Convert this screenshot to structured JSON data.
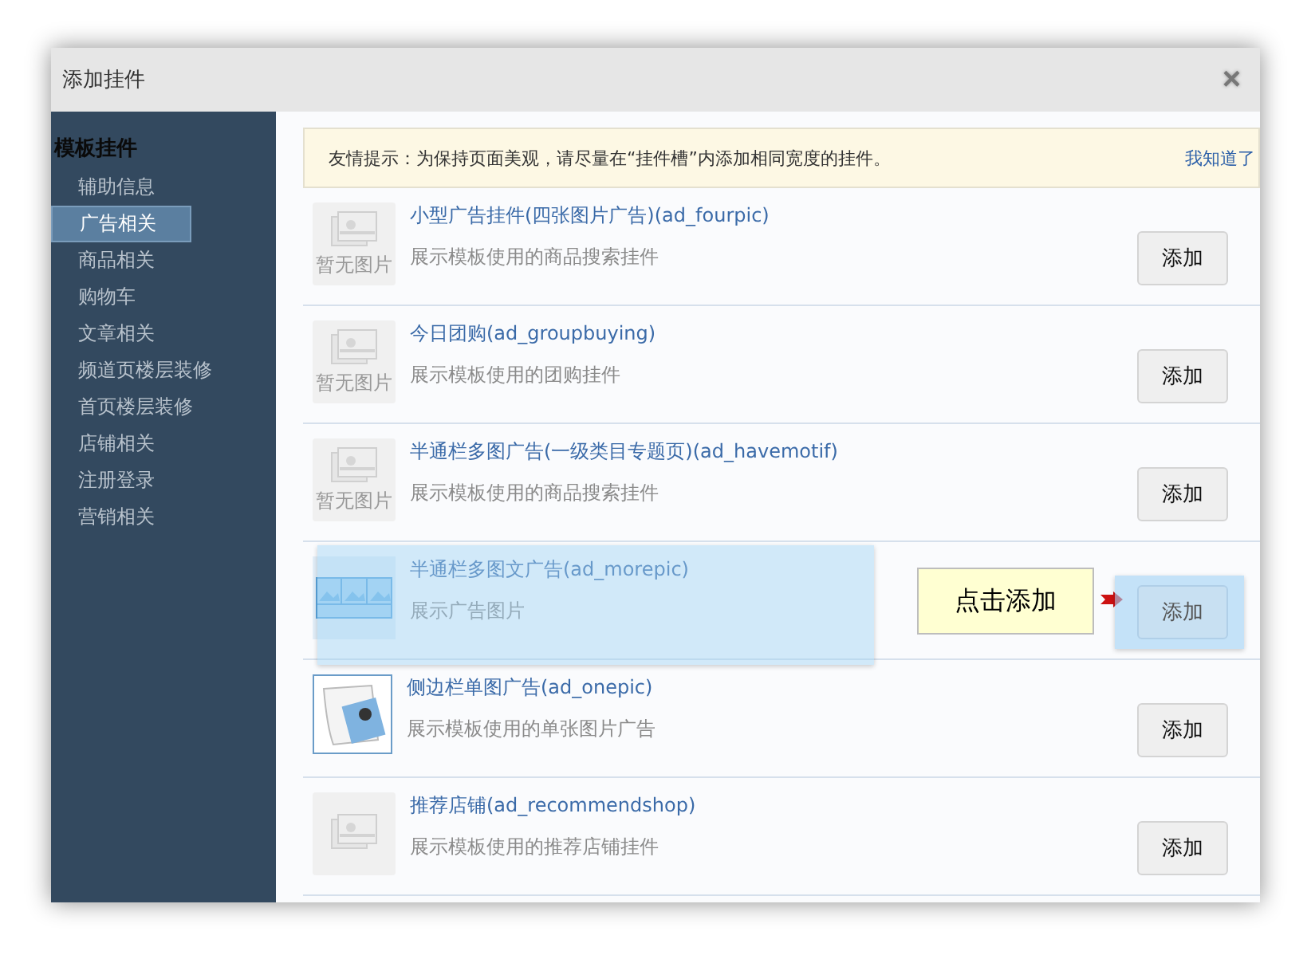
{
  "window": {
    "title": "添加挂件",
    "close": "×"
  },
  "sidebar": {
    "heading": "模板挂件",
    "items": [
      {
        "label": "辅助信息",
        "selected": false
      },
      {
        "label": "广告相关",
        "selected": true
      },
      {
        "label": "商品相关",
        "selected": false
      },
      {
        "label": "购物车",
        "selected": false
      },
      {
        "label": "文章相关",
        "selected": false
      },
      {
        "label": "频道页楼层装修",
        "selected": false
      },
      {
        "label": "首页楼层装修",
        "selected": false
      },
      {
        "label": "店铺相关",
        "selected": false
      },
      {
        "label": "注册登录",
        "selected": false
      },
      {
        "label": "营销相关",
        "selected": false
      }
    ]
  },
  "tip": {
    "text": "友情提示：为保持页面美观，请尽量在“挂件槽”内添加相同宽度的挂件。",
    "link": "我知道了"
  },
  "widgets": [
    {
      "kind": "placeholder",
      "thumb_text": "暂无图片",
      "title": "小型广告挂件(四张图片广告)(ad_fourpic)",
      "description": "展示模板使用的商品搜索挂件",
      "button": "添加",
      "dragging": false
    },
    {
      "kind": "placeholder",
      "thumb_text": "暂无图片",
      "title": "今日团购(ad_groupbuying)",
      "description": "展示模板使用的团购挂件",
      "button": "添加",
      "dragging": false
    },
    {
      "kind": "placeholder",
      "thumb_text": "暂无图片",
      "title": "半通栏多图广告(一级类目专题页)(ad_havemotif)",
      "description": "展示模板使用的商品搜索挂件",
      "button": "添加",
      "dragging": false
    },
    {
      "kind": "multipic",
      "title": "半通栏多图文广告(ad_morepic)",
      "description": "展示广告图片",
      "button": "添加",
      "dragging": true,
      "callout": "点击添加"
    },
    {
      "kind": "photo",
      "title": "侧边栏单图广告(ad_onepic)",
      "description": "展示模板使用的单张图片广告",
      "button": "添加",
      "dragging": false
    },
    {
      "kind": "placeholder",
      "title": "推荐店铺(ad_recommendshop)",
      "description": "展示模板使用的推荐店铺挂件",
      "button": "添加",
      "dragging": false
    }
  ]
}
